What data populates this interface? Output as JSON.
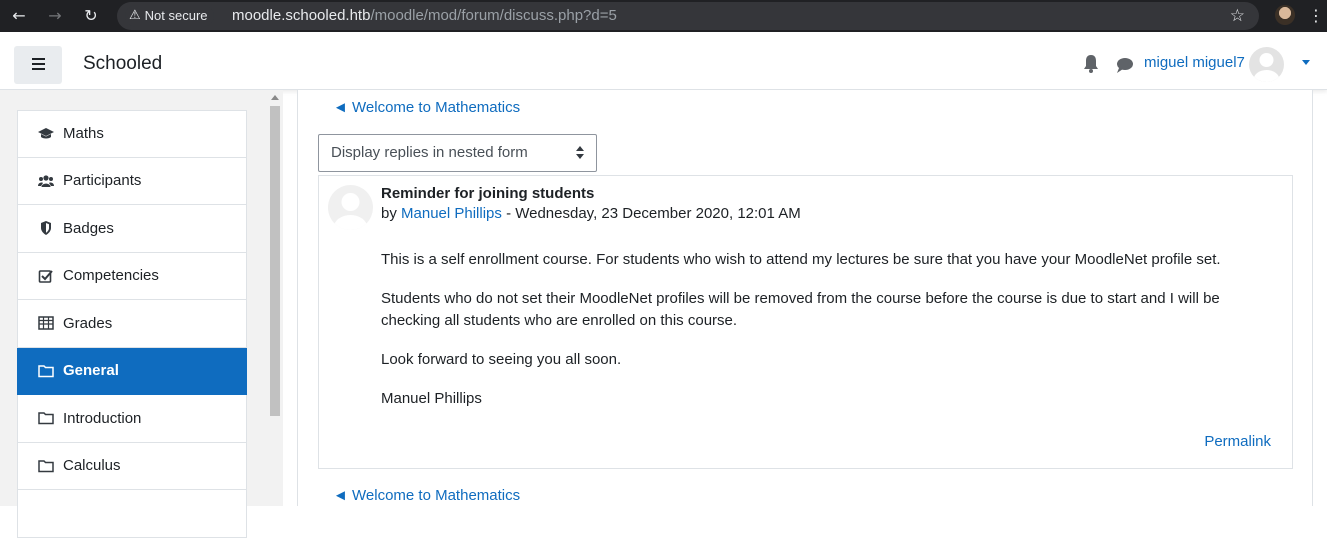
{
  "browser": {
    "security_label": "Not secure",
    "url_host": "moodle.schooled.htb",
    "url_path": "/moodle/mod/forum/discuss.php?d=5"
  },
  "navbar": {
    "brand": "Schooled",
    "user_name": "miguel miguel7"
  },
  "sidebar": {
    "items": [
      {
        "label": "Maths",
        "icon": "graduation-cap-icon"
      },
      {
        "label": "Participants",
        "icon": "users-icon"
      },
      {
        "label": "Badges",
        "icon": "shield-icon"
      },
      {
        "label": "Competencies",
        "icon": "check-square-icon"
      },
      {
        "label": "Grades",
        "icon": "table-icon"
      },
      {
        "label": "General",
        "icon": "folder-icon",
        "active": true
      },
      {
        "label": "Introduction",
        "icon": "folder-icon"
      },
      {
        "label": "Calculus",
        "icon": "folder-icon"
      }
    ]
  },
  "main": {
    "back_link": "◄ Welcome to Mathematics",
    "display_mode": "Display replies in nested form",
    "post": {
      "title": "Reminder for joining students",
      "by_prefix": "by",
      "author": "Manuel Phillips",
      "date": " - Wednesday, 23 December 2020, 12:01 AM",
      "paragraphs": [
        "This is a self enrollment course. For students who wish to attend my lectures be sure that you have your MoodleNet profile set.",
        "Students who do not set their MoodleNet profiles will be  removed from the course before the course is due to start and I will be checking all students who are enrolled on this course.",
        "Look forward to seeing you all soon.",
        "Manuel Phillips"
      ],
      "permalink": "Permalink"
    }
  },
  "colors": {
    "accent": "#0f6cbf",
    "chrome_bg": "#202124",
    "drawer_bg": "#f2f2f2"
  }
}
